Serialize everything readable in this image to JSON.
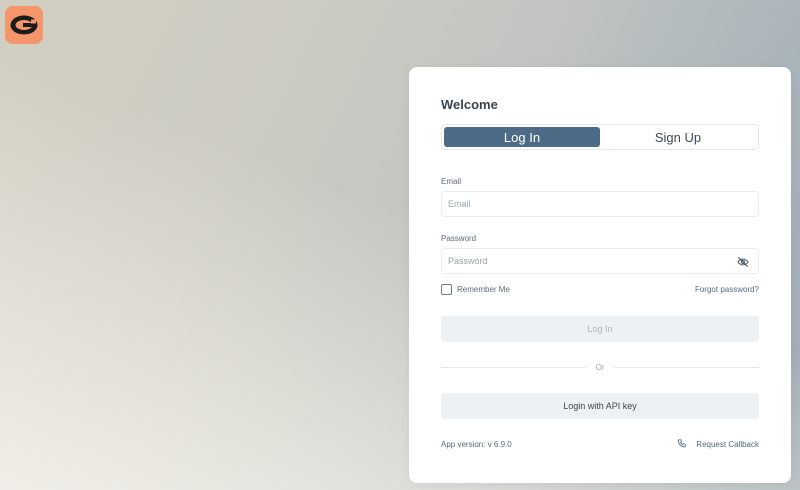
{
  "app": {
    "logo_icon": "brand-logo-icon",
    "accent_color": "#4d6a86",
    "logo_color": "#f4956a"
  },
  "login_card": {
    "title": "Welcome",
    "tabs": [
      {
        "label": "Log In",
        "active": true
      },
      {
        "label": "Sign Up",
        "active": false
      }
    ],
    "email": {
      "label": "Email",
      "placeholder": "Email",
      "value": ""
    },
    "password": {
      "label": "Password",
      "placeholder": "Password",
      "value": "",
      "toggle_icon": "eye-off-icon"
    },
    "remember_me": {
      "label": "Remember Me",
      "checked": false
    },
    "forgot_password_label": "Forgot password?",
    "login_button_label": "Log In",
    "divider_label": "Or",
    "api_key_button_label": "Login with API key",
    "app_version": "App version: v 6.9.0",
    "request_callback": {
      "label": "Request Callback",
      "icon": "phone-icon"
    }
  }
}
